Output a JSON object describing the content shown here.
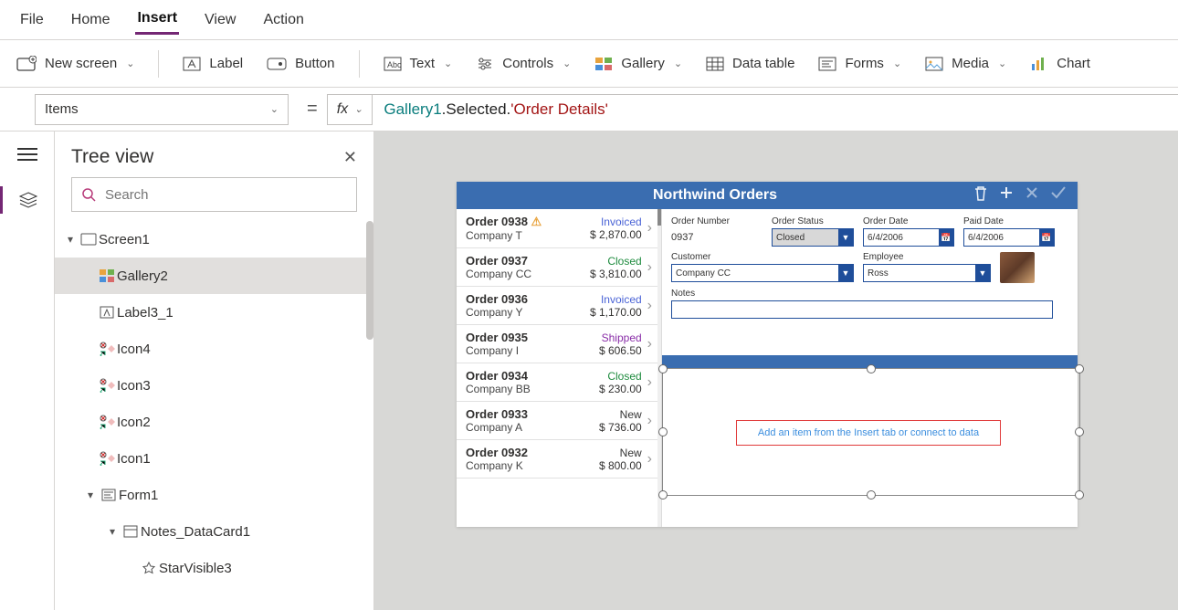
{
  "menu": {
    "file": "File",
    "home": "Home",
    "insert": "Insert",
    "view": "View",
    "action": "Action"
  },
  "ribbon": {
    "new_screen": "New screen",
    "label": "Label",
    "button": "Button",
    "text": "Text",
    "controls": "Controls",
    "gallery": "Gallery",
    "data_table": "Data table",
    "forms": "Forms",
    "media": "Media",
    "chart": "Chart"
  },
  "property": "Items",
  "formula": {
    "p1": "Gallery1",
    "p2": ".Selected.",
    "p3": "'Order Details'"
  },
  "tree": {
    "title": "Tree view",
    "search_placeholder": "Search",
    "nodes": {
      "screen": "Screen1",
      "gallery": "Gallery2",
      "label3": "Label3_1",
      "icon4": "Icon4",
      "icon3": "Icon3",
      "icon2": "Icon2",
      "icon1": "Icon1",
      "form1": "Form1",
      "notes": "Notes_DataCard1",
      "star": "StarVisible3"
    }
  },
  "app": {
    "title": "Northwind Orders",
    "labels": {
      "order_no": "Order Number",
      "order_status": "Order Status",
      "order_date": "Order Date",
      "paid_date": "Paid Date",
      "customer": "Customer",
      "employee": "Employee",
      "notes": "Notes"
    },
    "values": {
      "order_no": "0937",
      "order_status": "Closed",
      "order_date": "6/4/2006",
      "paid_date": "6/4/2006",
      "customer": "Company CC",
      "employee": "Ross"
    },
    "placeholder": {
      "t1": "Add an item from the Insert tab or ",
      "t2": "connect to data"
    },
    "orders": [
      {
        "title": "Order 0938",
        "warn": true,
        "company": "Company T",
        "status": "Invoiced",
        "status_cls": "st-inv",
        "price": "$ 2,870.00"
      },
      {
        "title": "Order 0937",
        "company": "Company CC",
        "status": "Closed",
        "status_cls": "st-closed",
        "price": "$ 3,810.00"
      },
      {
        "title": "Order 0936",
        "company": "Company Y",
        "status": "Invoiced",
        "status_cls": "st-inv",
        "price": "$ 1,170.00"
      },
      {
        "title": "Order 0935",
        "company": "Company I",
        "status": "Shipped",
        "status_cls": "st-ship",
        "price": "$ 606.50"
      },
      {
        "title": "Order 0934",
        "company": "Company BB",
        "status": "Closed",
        "status_cls": "st-closed",
        "price": "$ 230.00"
      },
      {
        "title": "Order 0933",
        "company": "Company A",
        "status": "New",
        "status_cls": "st-new",
        "price": "$ 736.00"
      },
      {
        "title": "Order 0932",
        "company": "Company K",
        "status": "New",
        "status_cls": "st-new",
        "price": "$ 800.00"
      }
    ]
  }
}
